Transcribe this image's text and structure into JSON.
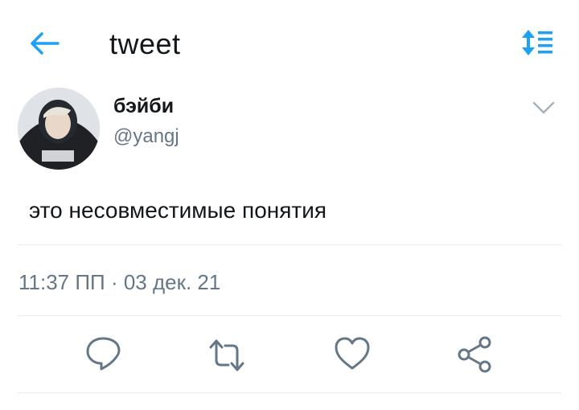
{
  "header": {
    "title": "tweet",
    "back_icon": "arrow-left-icon",
    "sort_icon": "sort-list-icon",
    "accent": "#1da1f2"
  },
  "tweet": {
    "display_name": "бэйби",
    "handle": "@yangj",
    "text": "это несовместимые понятия",
    "timestamp": "11:37 ПП · 03 дек. 21",
    "menu_icon": "chevron-down-icon"
  },
  "actions": [
    {
      "icon": "reply-icon"
    },
    {
      "icon": "retweet-icon"
    },
    {
      "icon": "like-icon"
    },
    {
      "icon": "share-icon"
    }
  ],
  "colors": {
    "text": "#14171a",
    "secondary": "#657786",
    "divider": "#e6ecf0",
    "icon": "#657786"
  }
}
